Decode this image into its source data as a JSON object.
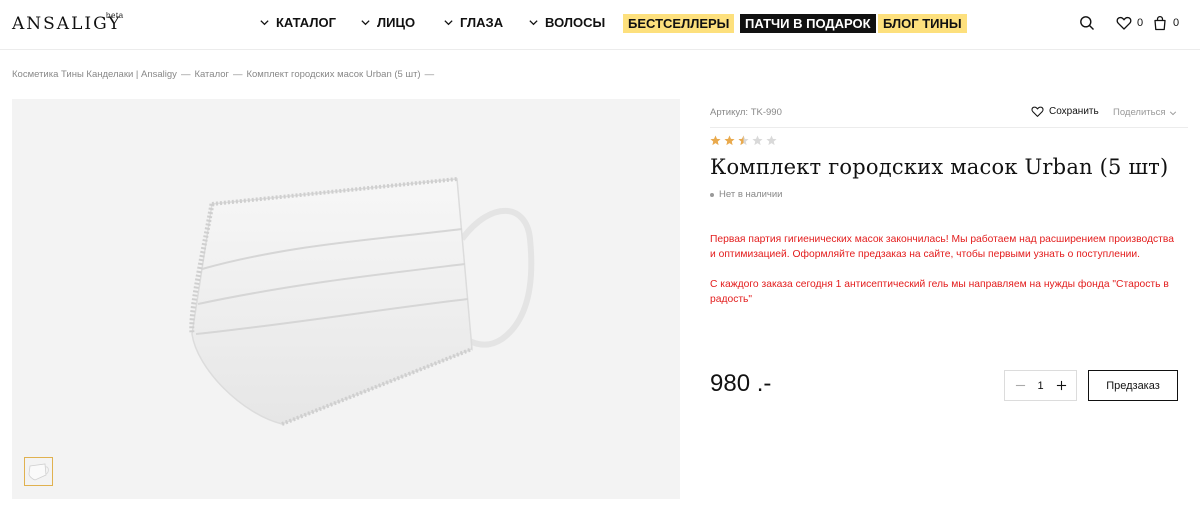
{
  "header": {
    "logo": "ANSALIGY",
    "logo_badge": "beta",
    "nav": [
      {
        "label": "КАТАЛОГ"
      },
      {
        "label": "ЛИЦО"
      },
      {
        "label": "ГЛАЗА"
      },
      {
        "label": "ВОЛОСЫ"
      }
    ],
    "promo": [
      {
        "label": "БЕСТСЕЛЛЕРЫ",
        "style": "yellow"
      },
      {
        "label": "ПАТЧИ В ПОДАРОК",
        "style": "black"
      },
      {
        "label": "БЛОГ ТИНЫ",
        "style": "yellow"
      }
    ],
    "wishlist_count": "0",
    "cart_count": "0"
  },
  "breadcrumb": [
    "Косметика Тины Канделаки | Ansaligy",
    "Каталог",
    "Комплект городских масок Urban (5 шт)"
  ],
  "breadcrumb_trailing": "—",
  "product": {
    "sku": "Артикул: TK-990",
    "save_label": "Сохранить",
    "share_label": "Поделиться",
    "rating": 2.5,
    "rating_max": 5,
    "title": "Комплект городских масок Urban (5 шт)",
    "availability": "Нет в наличии",
    "notice": [
      "Первая партия гигиенических масок закончилась! Мы работаем над расширением производства и оптимизацией. Оформляйте предзаказ на сайте, чтобы первыми узнать о поступлении.",
      "С каждого заказа сегодня 1 антисептический гель мы направляем на нужды фонда \"Старость в радость\""
    ],
    "price": "980 .-",
    "quantity": "1",
    "preorder_label": "Предзаказ"
  },
  "colors": {
    "accent_yellow": "#fde07d",
    "notice_red": "#e31d1d",
    "star_filled": "#e9a94c",
    "star_empty": "#d9d9d9"
  }
}
